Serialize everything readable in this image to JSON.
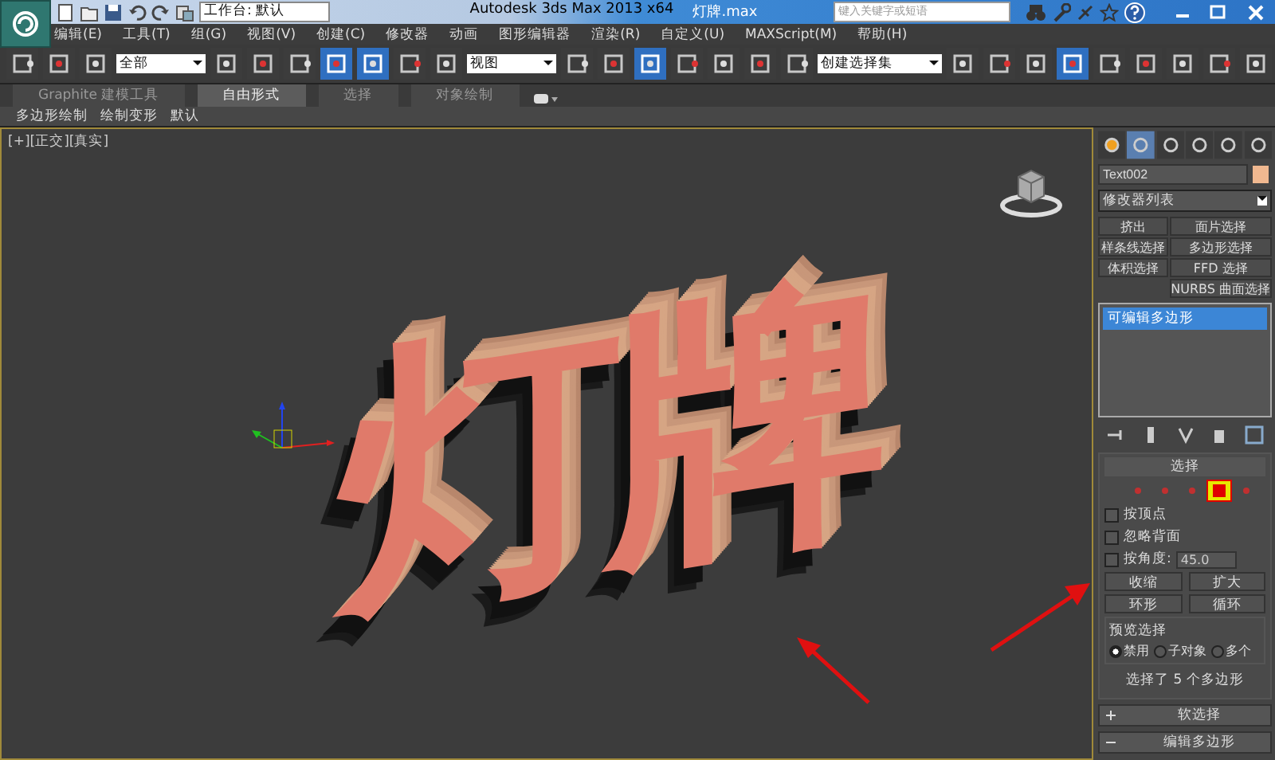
{
  "title_bar": {
    "workspace": "工作台: 默认",
    "app_title": "Autodesk 3ds Max  2013 x64",
    "file_name": "灯牌.max",
    "search": {
      "placeholder": "键入关键字或短语"
    }
  },
  "menu": [
    "编辑(E)",
    "工具(T)",
    "组(G)",
    "视图(V)",
    "创建(C)",
    "修改器",
    "动画",
    "图形编辑器",
    "渲染(R)",
    "自定义(U)",
    "MAXScript(M)",
    "帮助(H)"
  ],
  "toolbar": [
    {
      "kind": "icon",
      "selected": false
    },
    {
      "kind": "icon",
      "selected": false
    },
    {
      "kind": "icon",
      "selected": false
    },
    {
      "kind": "dropdown",
      "value": "全部"
    },
    {
      "kind": "icon",
      "selected": false
    },
    {
      "kind": "icon",
      "selected": false
    },
    {
      "kind": "icon",
      "selected": false
    },
    {
      "kind": "icon",
      "selected": true
    },
    {
      "kind": "icon",
      "selected": true
    },
    {
      "kind": "icon",
      "selected": false
    },
    {
      "kind": "icon",
      "selected": false
    },
    {
      "kind": "dropdown",
      "value": "视图"
    },
    {
      "kind": "icon",
      "selected": false
    },
    {
      "kind": "icon",
      "selected": false
    },
    {
      "kind": "icon",
      "selected": true
    },
    {
      "kind": "icon",
      "selected": false
    },
    {
      "kind": "icon",
      "selected": false
    },
    {
      "kind": "icon",
      "selected": false
    },
    {
      "kind": "icon",
      "selected": false
    },
    {
      "kind": "dropdown",
      "value": "创建选择集"
    },
    {
      "kind": "icon",
      "selected": false
    },
    {
      "kind": "icon",
      "selected": false
    },
    {
      "kind": "icon",
      "selected": false
    },
    {
      "kind": "icon",
      "selected": true
    },
    {
      "kind": "icon",
      "selected": false
    },
    {
      "kind": "icon",
      "selected": false
    },
    {
      "kind": "icon",
      "selected": false
    },
    {
      "kind": "icon",
      "selected": false
    },
    {
      "kind": "icon",
      "selected": false
    }
  ],
  "ribbon_tabs": [
    {
      "label": "Graphite 建模工具",
      "selected": false
    },
    {
      "label": "自由形式",
      "selected": true
    },
    {
      "label": "选择",
      "selected": false
    },
    {
      "label": "对象绘制",
      "selected": false
    }
  ],
  "ribbon_subtabs": [
    "多边形绘制",
    "绘制变形",
    "默认"
  ],
  "viewport": {
    "label": "[+][正交][真实]",
    "object_text": "灯牌"
  },
  "command_panel": {
    "tabs": [
      {
        "selected": false
      },
      {
        "selected": true
      },
      {
        "selected": false
      },
      {
        "selected": false
      },
      {
        "selected": false
      },
      {
        "selected": false
      }
    ],
    "object_name": "Text002",
    "modifier_list": "修改器列表",
    "modifier_buttons": [
      "挤出",
      "面片选择",
      "样条线选择",
      "多边形选择",
      "体积选择",
      "FFD 选择",
      "NURBS 曲面选择"
    ],
    "stack": [
      {
        "label": "可编辑多边形",
        "selected": true
      }
    ],
    "selection_rollout": {
      "title": "选择",
      "subobjects": [
        {
          "selected": false
        },
        {
          "selected": false
        },
        {
          "selected": false
        },
        {
          "selected": true
        },
        {
          "selected": false
        }
      ],
      "checkboxes": [
        {
          "label": "按顶点",
          "checked": false
        },
        {
          "label": "忽略背面",
          "checked": false
        },
        {
          "label": "按角度:",
          "checked": false,
          "value": "45.0"
        }
      ],
      "buttons": [
        "收缩",
        "扩大"
      ],
      "spinner_buttons": [
        "环形",
        "循环"
      ],
      "preview": {
        "title": "预览选择",
        "options": [
          {
            "label": "禁用",
            "selected": true
          },
          {
            "label": "子对象",
            "selected": false
          },
          {
            "label": "多个",
            "selected": false
          }
        ]
      },
      "status": "选择了 5 个多边形"
    },
    "rollouts": [
      {
        "title": "软选择",
        "expanded": false
      },
      {
        "title": "编辑多边形",
        "expanded": true
      }
    ]
  }
}
